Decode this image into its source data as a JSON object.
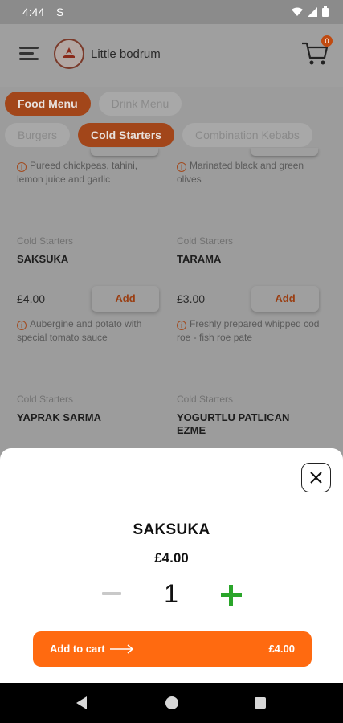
{
  "status_bar": {
    "time": "4:44",
    "s_icon": "S"
  },
  "header": {
    "brand": "Little bodrum",
    "cart_count": "0"
  },
  "menu_tabs": [
    {
      "label": "Food Menu"
    },
    {
      "label": "Drink Menu"
    }
  ],
  "categories": [
    {
      "label": "Burgers"
    },
    {
      "label": "Cold Starters"
    },
    {
      "label": "Combination Kebabs"
    }
  ],
  "top_descs": [
    "Pureed chickpeas, tahini, lemon juice and garlic",
    "Marinated black and green olives"
  ],
  "products": [
    {
      "category": "Cold Starters",
      "name": "SAKSUKA",
      "price": "£4.00",
      "add": "Add",
      "desc": "Aubergine and potato with special tomato sauce"
    },
    {
      "category": "Cold Starters",
      "name": "TARAMA",
      "price": "£3.00",
      "add": "Add",
      "desc": "Freshly prepared whipped cod roe - fish roe pate"
    },
    {
      "category": "Cold Starters",
      "name": "YAPRAK SARMA"
    },
    {
      "category": "Cold Starters",
      "name": "YOGURTLU PATLICAN EZME"
    }
  ],
  "sheet": {
    "item_name": "SAKSUKA",
    "item_price": "£4.00",
    "quantity": "1",
    "add_to_cart": "Add to cart",
    "total": "£4.00"
  }
}
